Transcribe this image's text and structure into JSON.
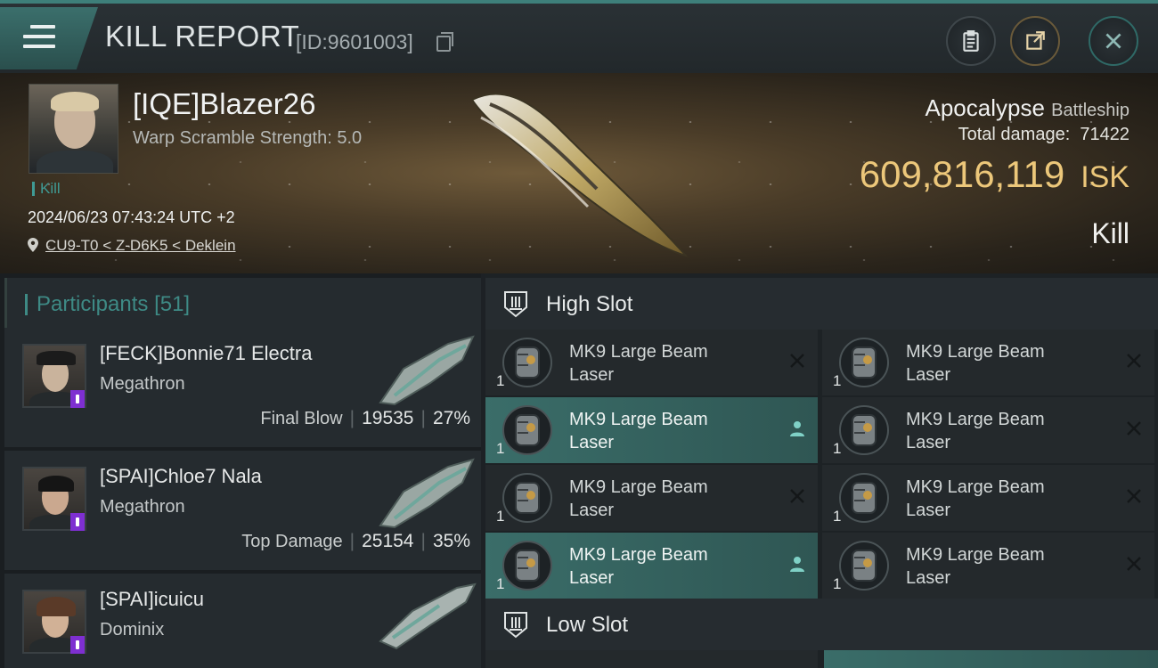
{
  "header": {
    "title": "KILL REPORT",
    "report_id": "[ID:9601003]",
    "buttons": [
      "clipboard-icon",
      "share-icon",
      "close-icon"
    ]
  },
  "victim": {
    "name": "[IQE]Blazer26",
    "warp_scramble": "Warp Scramble Strength: 5.0",
    "kill_tag": "Kill",
    "datetime": "2024/06/23 07:43:24 UTC +2",
    "location": "CU9-T0 < Z-D6K5 < Deklein",
    "ship_name": "Apocalypse",
    "ship_class": "Battleship",
    "total_damage_label": "Total damage:",
    "total_damage": "71422",
    "isk_value": "609,816,119",
    "isk_unit": "ISK",
    "result": "Kill"
  },
  "participants": {
    "title": "Participants",
    "count": "[51]",
    "items": [
      {
        "name": "[FECK]Bonnie71 Electra",
        "ship": "Megathron",
        "role": "Final Blow",
        "damage": "19535",
        "percent": "27%"
      },
      {
        "name": "[SPAI]Chloe7 Nala",
        "ship": "Megathron",
        "role": "Top Damage",
        "damage": "25154",
        "percent": "35%"
      },
      {
        "name": "[SPAI]icuicu",
        "ship": "Dominix",
        "role": "",
        "damage": "",
        "percent": ""
      }
    ]
  },
  "slots": {
    "high_label": "High Slot",
    "low_label": "Low Slot",
    "modules": [
      {
        "line1": "MK9 Large Beam",
        "line2": "Laser",
        "qty": "1",
        "state": "destroyed"
      },
      {
        "line1": "MK9 Large Beam",
        "line2": "Laser",
        "qty": "1",
        "state": "destroyed"
      },
      {
        "line1": "MK9 Large Beam",
        "line2": "Laser",
        "qty": "1",
        "state": "dropped"
      },
      {
        "line1": "MK9 Large Beam",
        "line2": "Laser",
        "qty": "1",
        "state": "destroyed"
      },
      {
        "line1": "MK9 Large Beam",
        "line2": "Laser",
        "qty": "1",
        "state": "destroyed"
      },
      {
        "line1": "MK9 Large Beam",
        "line2": "Laser",
        "qty": "1",
        "state": "destroyed"
      },
      {
        "line1": "MK9 Large Beam",
        "line2": "Laser",
        "qty": "1",
        "state": "dropped"
      },
      {
        "line1": "MK9 Large Beam",
        "line2": "Laser",
        "qty": "1",
        "state": "destroyed"
      }
    ]
  },
  "colors": {
    "accent": "#3e8a85",
    "isk": "#ecc77a",
    "highlight": "#3a6d69",
    "badge": "#7e2fd1"
  }
}
